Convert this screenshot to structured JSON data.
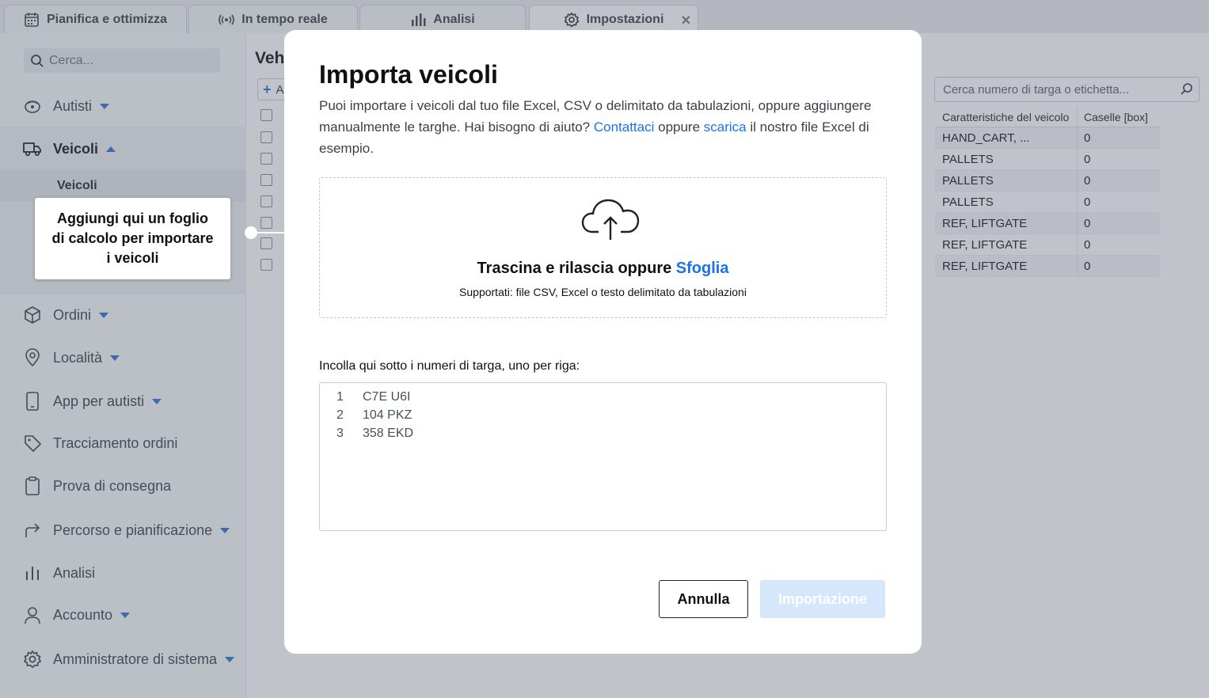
{
  "tabs": [
    {
      "label": "Pianifica e ottimizza",
      "icon": "calendar-icon"
    },
    {
      "label": "In tempo reale",
      "icon": "broadcast-icon"
    },
    {
      "label": "Analisi",
      "icon": "bar-chart-icon"
    },
    {
      "label": "Impostazioni",
      "icon": "gear-icon",
      "active": true
    }
  ],
  "sidebar": {
    "search_placeholder": "Cerca...",
    "items": [
      {
        "label": "Autisti",
        "icon": "drivers-icon"
      },
      {
        "label": "Veicoli",
        "icon": "truck-icon"
      },
      {
        "label": "Ordini",
        "icon": "box-icon"
      },
      {
        "label": "Località",
        "icon": "location-pin-icon"
      },
      {
        "label": "App per autisti",
        "icon": "phone-icon"
      },
      {
        "label": "Tracciamento ordini",
        "icon": "tag-icon"
      },
      {
        "label": "Prova di consegna",
        "icon": "clipboard-icon"
      },
      {
        "label": "Percorso e pianificazione",
        "icon": "route-arrow-icon"
      },
      {
        "label": "Analisi",
        "icon": "bar-chart-icon"
      },
      {
        "label": "Accounto",
        "icon": "user-icon"
      },
      {
        "label": "Amministratore di sistema",
        "icon": "gear-icon"
      }
    ],
    "subitem": "Veicoli"
  },
  "tooltip": {
    "text": "Aggiungi qui un foglio di calcolo per importare i veicoli"
  },
  "main": {
    "title": "Veh",
    "add_label": "A",
    "search_placeholder": "Cerca numero di targa o etichetta...",
    "table": {
      "columns": [
        "Caratteristiche del veicolo",
        "Caselle [box]"
      ],
      "rows": [
        [
          "HAND_CART, ...",
          "0"
        ],
        [
          "PALLETS",
          "0"
        ],
        [
          "PALLETS",
          "0"
        ],
        [
          "PALLETS",
          "0"
        ],
        [
          "REF, LIFTGATE",
          "0"
        ],
        [
          "REF, LIFTGATE",
          "0"
        ],
        [
          "REF, LIFTGATE",
          "0"
        ]
      ]
    }
  },
  "modal": {
    "title": "Importa veicoli",
    "desc_1": "Puoi importare i veicoli dal tuo file Excel, CSV o delimitato da tabulazioni, oppure aggiungere manualmente le targhe. Hai bisogno di aiuto? ",
    "link_contact": "Contattaci",
    "desc_2": " oppure ",
    "link_download": "scarica",
    "desc_3": " il nostro file Excel di esempio.",
    "drop_title": "Trascina e rilascia oppure ",
    "drop_link": "Sfoglia",
    "drop_sub": "Supportati: file CSV, Excel o testo delimitato da tabulazioni",
    "paste_label": "Incolla qui sotto i numeri di targa, uno per riga:",
    "plates": [
      {
        "n": "1",
        "v": "C7E U6I"
      },
      {
        "n": "2",
        "v": "104 PKZ"
      },
      {
        "n": "3",
        "v": "358 EKD"
      }
    ],
    "cancel_label": "Annulla",
    "import_label": "Importazione"
  },
  "colors": {
    "accent": "#1a73e8",
    "caret": "#2b6fd6",
    "import_disabled": "#d6e7fb"
  }
}
